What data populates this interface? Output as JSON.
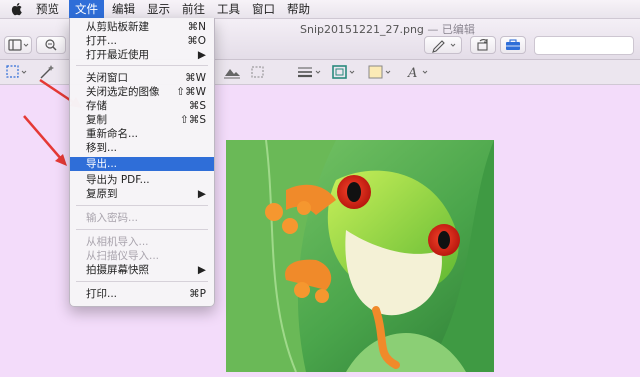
{
  "menubar": {
    "items": [
      "预览",
      "文件",
      "编辑",
      "显示",
      "前往",
      "工具",
      "窗口",
      "帮助"
    ],
    "active": "文件"
  },
  "window": {
    "title": "Snip20151221_27.png",
    "subtitle": " — 已编辑"
  },
  "file_menu": {
    "items": [
      {
        "label": "从剪贴板新建",
        "shortcut": "⌘N"
      },
      {
        "label": "打开...",
        "shortcut": "⌘O"
      },
      {
        "label": "打开最近使用",
        "shortcut": "▶"
      },
      {
        "label": "关闭窗口",
        "shortcut": "⌘W"
      },
      {
        "label": "关闭选定的图像",
        "shortcut": "⇧⌘W"
      },
      {
        "label": "存储",
        "shortcut": "⌘S"
      },
      {
        "label": "复制",
        "shortcut": "⇧⌘S"
      },
      {
        "label": "重新命名...",
        "shortcut": ""
      },
      {
        "label": "移到...",
        "shortcut": ""
      },
      {
        "label": "导出...",
        "shortcut": ""
      },
      {
        "label": "导出为 PDF...",
        "shortcut": ""
      },
      {
        "label": "复原到",
        "shortcut": "▶"
      },
      {
        "label": "输入密码...",
        "shortcut": ""
      },
      {
        "label": "从相机导入...",
        "shortcut": ""
      },
      {
        "label": "从扫描仪导入...",
        "shortcut": ""
      },
      {
        "label": "拍摄屏幕快照",
        "shortcut": "▶"
      },
      {
        "label": "打印...",
        "shortcut": "⌘P"
      }
    ]
  },
  "colors": {
    "highlight": "#2f6ed8",
    "annotation_arrow": "#e53935",
    "window_background": "#f3dcfa"
  },
  "icons": [
    "apple-icon",
    "sidebar-toggle-icon",
    "zoom-icon",
    "pen-icon",
    "rotate-icon",
    "toolbox-icon",
    "selection-icon",
    "magic-wand-icon",
    "adjust-icon",
    "crop-icon",
    "lines-icon",
    "border-icon",
    "fill-color-icon",
    "text-style-icon"
  ]
}
